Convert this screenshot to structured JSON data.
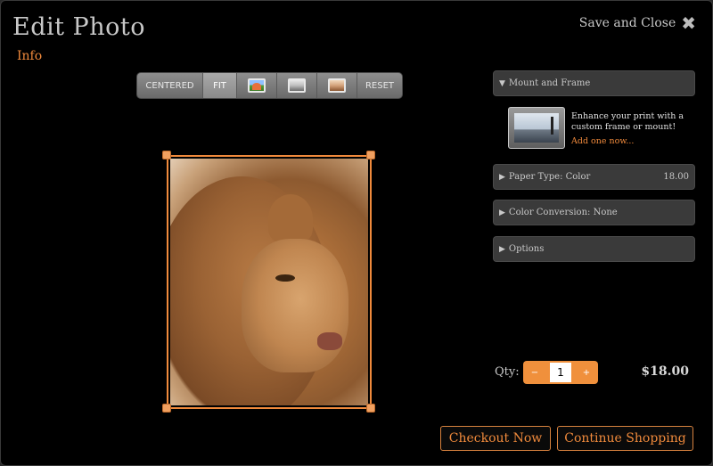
{
  "header": {
    "title": "Edit Photo",
    "info_link": "Info",
    "save_close": "Save and Close"
  },
  "toolbar": {
    "centered": "CENTERED",
    "fit": "FIT",
    "icons": [
      "color-mode-icon",
      "black-white-mode-icon",
      "sepia-mode-icon"
    ],
    "reset": "RESET"
  },
  "panels": {
    "mount": {
      "label": "Mount and Frame",
      "expanded": true
    },
    "promo_text": "Enhance your print with a custom frame or mount!",
    "promo_link": "Add one now...",
    "paper": {
      "label": "Paper Type: Color",
      "price": "18.00"
    },
    "color": {
      "label": "Color Conversion: None"
    },
    "options": {
      "label": "Options"
    }
  },
  "order": {
    "qty_label": "Qty:",
    "quantity": "1",
    "minus": "−",
    "plus": "+",
    "total": "$18.00"
  },
  "actions": {
    "checkout": "Checkout Now",
    "continue": "Continue Shopping"
  },
  "colors": {
    "accent": "#f08a3c",
    "panel_bg": "#3a3a3a",
    "background": "#000000"
  }
}
